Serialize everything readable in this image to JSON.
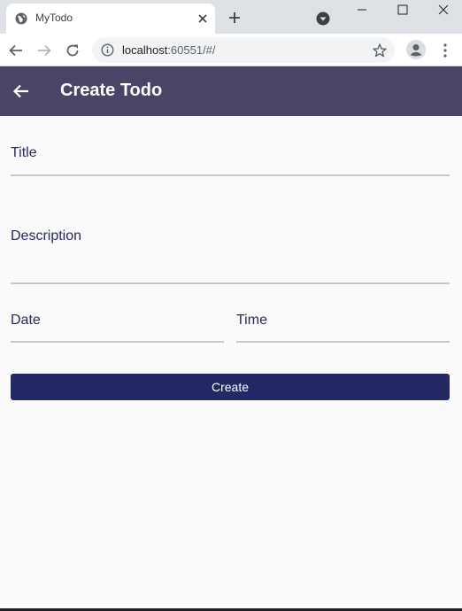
{
  "browser": {
    "tab_title": "MyTodo",
    "url_host": "localhost",
    "url_path": ":60551/#/",
    "icons": {
      "favicon": "globe-icon",
      "tab_close": "close-icon",
      "new_tab": "plus-icon",
      "tab_search": "dropdown-circle-icon",
      "minimize": "minimize-icon",
      "maximize": "maximize-icon",
      "close_window": "close-icon",
      "back": "arrow-left-icon",
      "forward": "arrow-right-icon",
      "reload": "reload-icon",
      "site_info": "info-icon",
      "bookmark": "star-icon",
      "profile": "profile-icon",
      "menu": "kebab-menu-icon"
    }
  },
  "appbar": {
    "title": "Create Todo",
    "back_icon": "arrow-left-icon",
    "background": "#4c4466"
  },
  "form": {
    "title_label": "Title",
    "title_value": "",
    "description_label": "Description",
    "description_value": "",
    "date_label": "Date",
    "date_value": "",
    "time_label": "Time",
    "time_value": "",
    "submit_label": "Create",
    "accent": "#242864"
  }
}
